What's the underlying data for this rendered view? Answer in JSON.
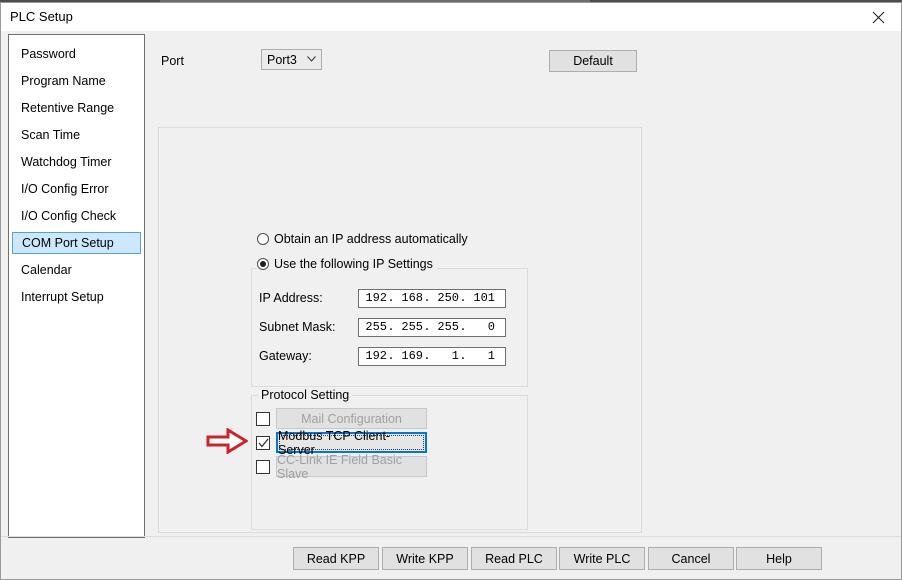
{
  "window": {
    "title": "PLC Setup",
    "close_icon": "close-icon"
  },
  "sidebar": {
    "items": [
      {
        "label": "Password",
        "selected": false
      },
      {
        "label": "Program Name",
        "selected": false
      },
      {
        "label": "Retentive Range",
        "selected": false
      },
      {
        "label": "Scan Time",
        "selected": false
      },
      {
        "label": "Watchdog Timer",
        "selected": false
      },
      {
        "label": "I/O Config Error",
        "selected": false
      },
      {
        "label": "I/O Config Check",
        "selected": false
      },
      {
        "label": "COM Port Setup",
        "selected": true
      },
      {
        "label": "Calendar",
        "selected": false
      },
      {
        "label": "Interrupt Setup",
        "selected": false
      }
    ]
  },
  "toolbar": {
    "port_label": "Port",
    "port_value": "Port3",
    "port_dropdown_icon": "chevron-down-icon",
    "default_label": "Default"
  },
  "ip_section": {
    "auto_radio_label": "Obtain an IP address automatically",
    "auto_radio_selected": false,
    "static_radio_label": "Use the following IP Settings",
    "static_radio_selected": true,
    "rows": [
      {
        "label": "IP Address:",
        "octets": [
          "192",
          "168",
          "250",
          "101"
        ]
      },
      {
        "label": "Subnet Mask:",
        "octets": [
          "255",
          "255",
          "255",
          "0"
        ]
      },
      {
        "label": "Gateway:",
        "octets": [
          "192",
          "169",
          "1",
          "1"
        ]
      }
    ]
  },
  "protocol_section": {
    "legend": "Protocol Setting",
    "items": [
      {
        "label": "Mail Configuration",
        "checked": false,
        "enabled": false,
        "focused": false
      },
      {
        "label": "Modbus TCP Client-Server",
        "checked": true,
        "enabled": true,
        "focused": true
      },
      {
        "label": "CC-Link IE Field Basic Slave",
        "checked": false,
        "enabled": false,
        "focused": false
      }
    ]
  },
  "annotation": {
    "arrow_icon": "right-arrow-icon",
    "arrow_color": "#cc2229"
  },
  "footer": {
    "buttons": [
      {
        "label": "Read KPP"
      },
      {
        "label": "Write KPP"
      },
      {
        "label": "Read PLC"
      },
      {
        "label": "Write PLC"
      },
      {
        "label": "Cancel"
      },
      {
        "label": "Help"
      }
    ]
  }
}
